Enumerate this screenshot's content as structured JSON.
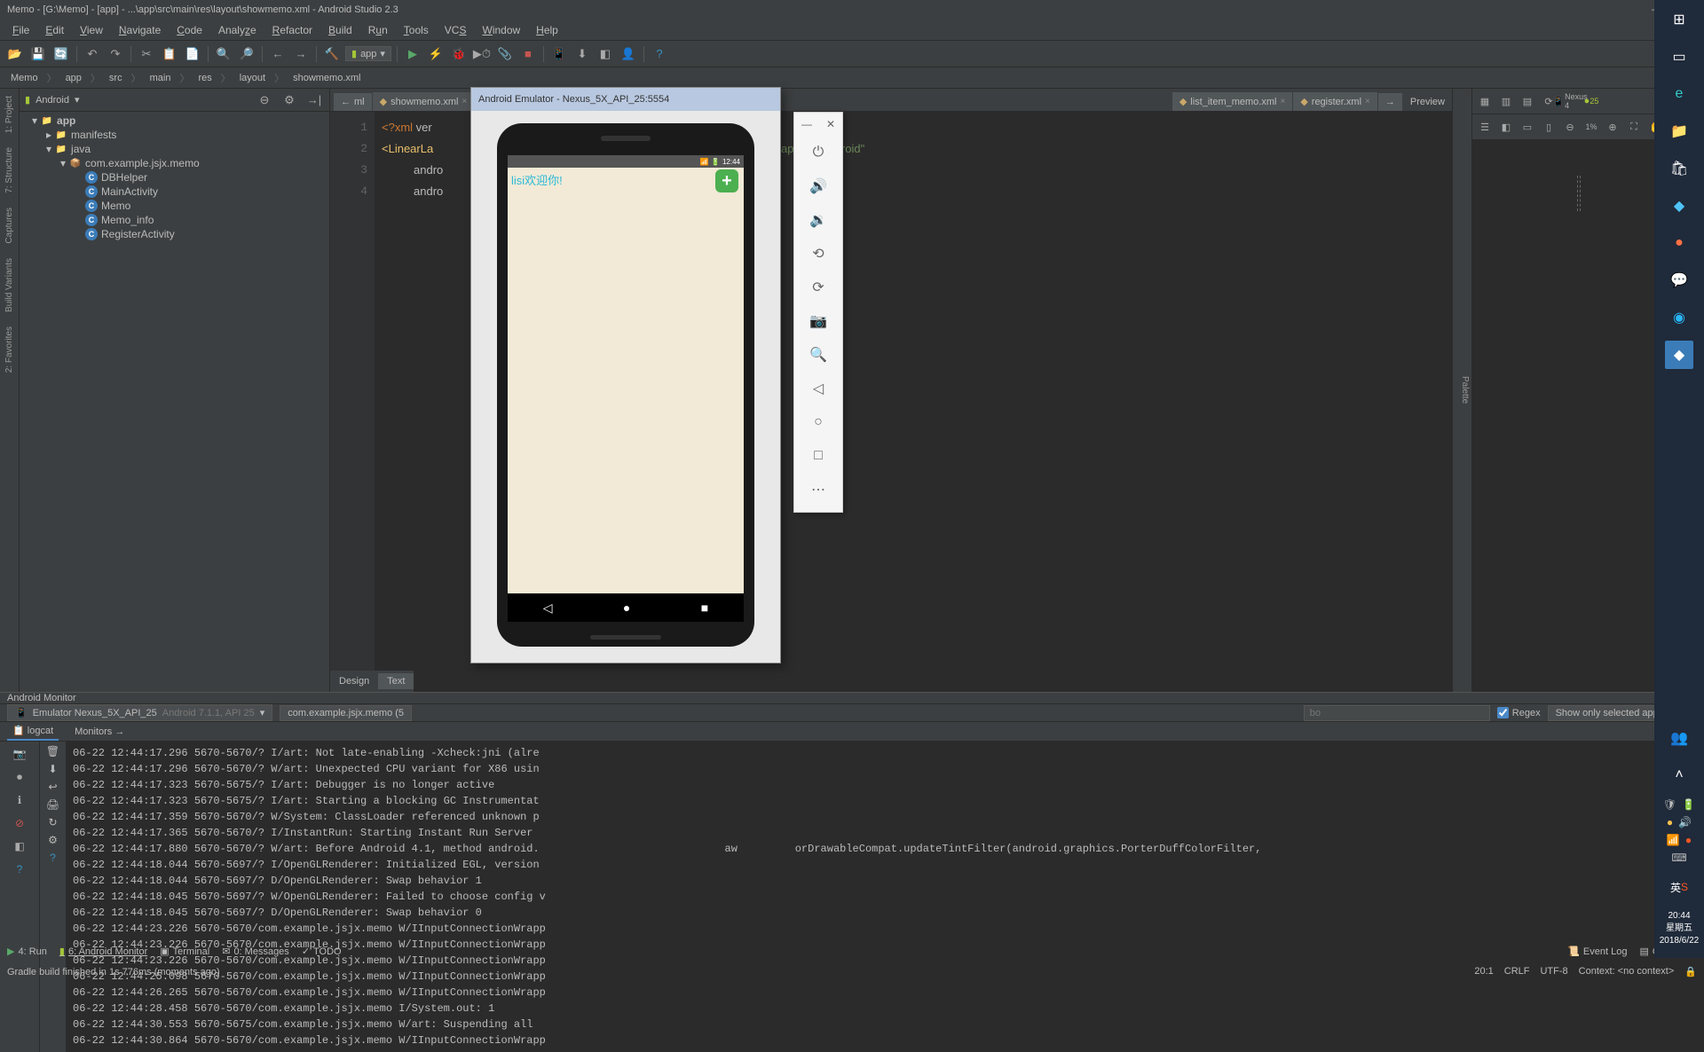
{
  "title": "Memo - [G:\\Memo] - [app] - ...\\app\\src\\main\\res\\layout\\showmemo.xml - Android Studio 2.3",
  "menu": [
    "File",
    "Edit",
    "View",
    "Navigate",
    "Code",
    "Analyze",
    "Refactor",
    "Build",
    "Run",
    "Tools",
    "VCS",
    "Window",
    "Help"
  ],
  "runConfig": "app",
  "breadcrumb": [
    "Memo",
    "app",
    "src",
    "main",
    "res",
    "layout",
    "showmemo.xml"
  ],
  "project": {
    "header": "Android",
    "root": "app",
    "manifests": "manifests",
    "java": "java",
    "package": "com.example.jsjx.memo",
    "classes": [
      "DBHelper",
      "MainActivity",
      "Memo",
      "Memo_info",
      "RegisterActivity"
    ]
  },
  "editorTabs": {
    "left": "ml",
    "active": "showmemo.xml",
    "right1": "list_item_memo.xml",
    "right2": "register.xml",
    "preview": "Preview"
  },
  "code": {
    "l1a": "<?xml ",
    "l1b": "ver",
    "l2a": "<LinearLa",
    "l3": "andro",
    "l4": "andro",
    "l2url": ".com/apk/res/android\""
  },
  "designTabs": {
    "design": "Design",
    "text": "Text"
  },
  "previewDevice": "Nexus 4",
  "previewApi": "25",
  "previewZoom": "1%",
  "monitor": {
    "title": "Android Monitor",
    "device": "Emulator Nexus_5X_API_25",
    "deviceInfo": "Android 7.1.1, API 25",
    "process": "com.example.jsjx.memo (5",
    "tabLogcat": "logcat",
    "tabMonitors": "Monitors",
    "regex": "Regex",
    "filter": "Show only selected application",
    "searchHint": "bo"
  },
  "log": [
    "06-22 12:44:17.296 5670-5670/? I/art: Not late-enabling -Xcheck:jni (alre",
    "06-22 12:44:17.296 5670-5670/? W/art: Unexpected CPU variant for X86 usin",
    "06-22 12:44:17.323 5670-5675/? I/art: Debugger is no longer active",
    "06-22 12:44:17.323 5670-5675/? I/art: Starting a blocking GC Instrumentat",
    "06-22 12:44:17.359 5670-5670/? W/System: ClassLoader referenced unknown p",
    "06-22 12:44:17.365 5670-5670/? I/InstantRun: Starting Instant Run Server",
    "06-22 12:44:17.880 5670-5670/? W/art: Before Android 4.1, method android.                             aw         orDrawableCompat.updateTintFilter(android.graphics.PorterDuffColorFilter,",
    "06-22 12:44:18.044 5670-5697/? I/OpenGLRenderer: Initialized EGL, version",
    "06-22 12:44:18.044 5670-5697/? D/OpenGLRenderer: Swap behavior 1",
    "06-22 12:44:18.045 5670-5697/? W/OpenGLRenderer: Failed to choose config v",
    "06-22 12:44:18.045 5670-5697/? D/OpenGLRenderer: Swap behavior 0",
    "06-22 12:44:23.226 5670-5670/com.example.jsjx.memo W/IInputConnectionWrapp",
    "06-22 12:44:23.226 5670-5670/com.example.jsjx.memo W/IInputConnectionWrapp",
    "06-22 12:44:23.226 5670-5670/com.example.jsjx.memo W/IInputConnectionWrapp",
    "06-22 12:44:25.098 5670-5670/com.example.jsjx.memo W/IInputConnectionWrapp",
    "06-22 12:44:26.265 5670-5670/com.example.jsjx.memo W/IInputConnectionWrapp",
    "06-22 12:44:28.458 5670-5670/com.example.jsjx.memo I/System.out: 1",
    "06-22 12:44:30.553 5670-5675/com.example.jsjx.memo W/art: Suspending all",
    "06-22 12:44:30.864 5670-5670/com.example.jsjx.memo W/IInputConnectionWrapp"
  ],
  "bottomTabs": {
    "run": "4: Run",
    "monitor": "6: Android Monitor",
    "terminal": "Terminal",
    "messages": "0: Messages",
    "todo": "TODO",
    "eventlog": "Event Log",
    "gradle": "Gradle Co"
  },
  "status": {
    "msg": "Gradle build finished in 1s 776ms (moments ago)",
    "pos": "20:1",
    "crlf": "CRLF",
    "enc": "UTF-8",
    "ctx": "Context: <no context>"
  },
  "emulator": {
    "title": "Android Emulator - Nexus_5X_API_25:5554",
    "time": "12:44",
    "welcome": "lisi欢迎你!"
  },
  "taskbar": {
    "time": "20:44",
    "day": "星期五",
    "date": "2018/6/22",
    "ime": "英"
  }
}
